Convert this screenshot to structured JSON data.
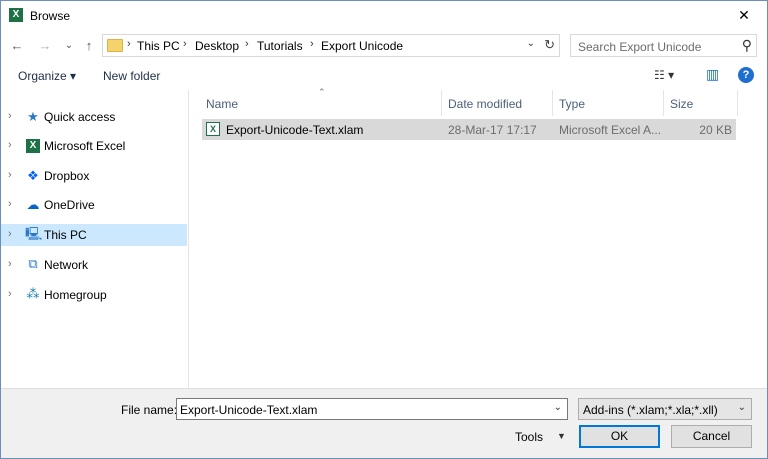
{
  "window": {
    "title": "Browse",
    "app_icon": "excel-icon",
    "close_glyph": "✕"
  },
  "nav": {
    "back_glyph": "←",
    "forward_glyph": "→",
    "recent_glyph": "⌄",
    "up_glyph": "↑",
    "breadcrumbs": [
      "This PC",
      "Desktop",
      "Tutorials",
      "Export Unicode"
    ],
    "separator": "›",
    "dropdown_glyph": "⌄",
    "refresh_glyph": "↻"
  },
  "search": {
    "placeholder": "Search Export Unicode",
    "icon_glyph": "⚲"
  },
  "toolbar": {
    "organize_label": "Organize ▾",
    "new_folder_label": "New folder",
    "view_glyph": "☷ ▾",
    "preview_glyph": "▥",
    "help_glyph": "?"
  },
  "sidebar": {
    "items": [
      {
        "label": "Quick access",
        "icon": "star-icon",
        "glyph": "★",
        "color": "#2b78c5"
      },
      {
        "label": "Microsoft Excel",
        "icon": "excel-icon",
        "glyph": "X",
        "color": "#1e7145"
      },
      {
        "label": "Dropbox",
        "icon": "dropbox-icon",
        "glyph": "❖",
        "color": "#0061fe"
      },
      {
        "label": "OneDrive",
        "icon": "cloud-icon",
        "glyph": "☁",
        "color": "#0a64c8"
      },
      {
        "label": "This PC",
        "icon": "computer-icon",
        "glyph": "🖳",
        "color": "#2b78c5"
      },
      {
        "label": "Network",
        "icon": "network-icon",
        "glyph": "⧉",
        "color": "#2b78c5"
      },
      {
        "label": "Homegroup",
        "icon": "homegroup-icon",
        "glyph": "⁂",
        "color": "#1a7fb5"
      }
    ],
    "chevron_glyph": "›",
    "selected_index": 4
  },
  "filelist": {
    "sort_glyph": "⌃",
    "columns": [
      "Name",
      "Date modified",
      "Type",
      "Size"
    ],
    "files": [
      {
        "name": "Export-Unicode-Text.xlam",
        "date": "28-Mar-17 17:17",
        "type": "Microsoft Excel A...",
        "size": "20 KB",
        "icon_glyph": "X"
      }
    ]
  },
  "footer": {
    "file_name_label": "File name:",
    "file_name_value": "Export-Unicode-Text.xlam",
    "filter_value": "Add-ins (*.xlam;*.xla;*.xll)",
    "dropdown_glyph": "⌄",
    "tools_label": "Tools",
    "tools_dd_glyph": "▼",
    "ok_label": "OK",
    "cancel_label": "Cancel"
  }
}
